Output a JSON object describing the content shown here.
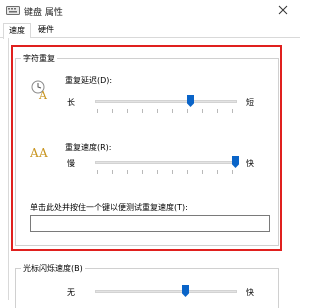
{
  "window": {
    "title": "键盘 属性"
  },
  "tabs": [
    {
      "label": "速度"
    },
    {
      "label": "硬件"
    }
  ],
  "char_repeat": {
    "group_title": "字符重复",
    "delay": {
      "label": "重复延迟(D):",
      "left": "长",
      "right": "短",
      "level": 0.67
    },
    "rate": {
      "label": "重复速度(R):",
      "left": "慢",
      "right": "快",
      "level": 1.0
    },
    "test": {
      "label": "单击此处并按住一个键以便测试重复速度(T):",
      "value": ""
    }
  },
  "cursor_blink": {
    "group_title": "光标闪烁速度(B)",
    "left": "无",
    "right": "快",
    "level": 0.6
  },
  "colors": {
    "highlight": "#e0201e",
    "thumb": "#0a64c8"
  }
}
